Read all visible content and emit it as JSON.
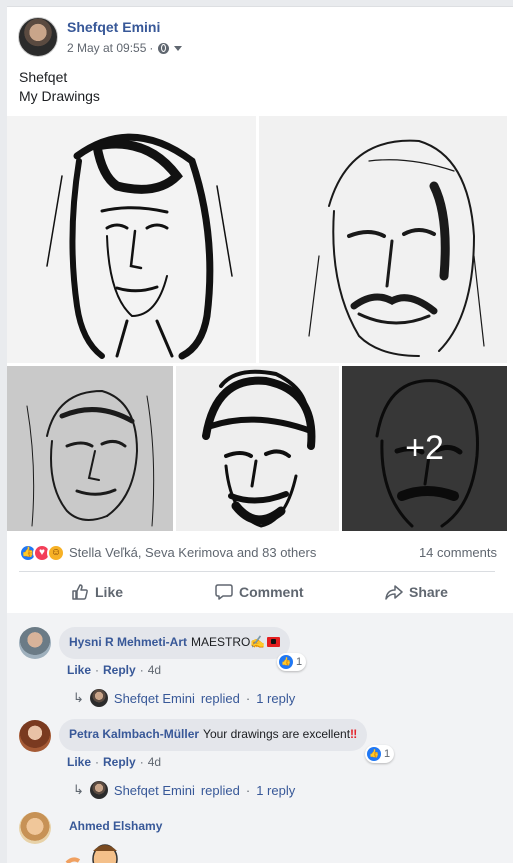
{
  "post": {
    "author": "Shefqet Emini",
    "timestamp": "2 May at 09:55",
    "meta_separator": "·",
    "text_lines": [
      "Shefqet",
      "My Drawings"
    ],
    "more_photos_label": "+2"
  },
  "reactions": {
    "names": "Stella Veľká, Seva Kerimova and 83 others",
    "comments_count": "14 comments",
    "icons": [
      "like-reaction-icon",
      "love-reaction-icon",
      "care-reaction-icon"
    ],
    "colors": {
      "like": "#2078f4",
      "love": "#f33e58",
      "care": "#f7b125"
    }
  },
  "actions": {
    "like": "Like",
    "comment": "Comment",
    "share": "Share"
  },
  "comments": [
    {
      "name": "Hysni R Mehmeti-Art",
      "text": "MAESTRO",
      "emoji": "✍",
      "like": "Like",
      "reply": "Reply",
      "time": "4d",
      "reaction_count": "1",
      "reply_preview": {
        "author": "Shefqet Emini",
        "verb": "replied",
        "sep": "·",
        "count": "1 reply"
      }
    },
    {
      "name": "Petra Kalmbach-Müller",
      "text": "Your drawings are excellent",
      "emoji": "‼",
      "like": "Like",
      "reply": "Reply",
      "time": "4d",
      "reaction_count": "1",
      "reply_preview": {
        "author": "Shefqet Emini",
        "verb": "replied",
        "sep": "·",
        "count": "1 reply"
      }
    },
    {
      "name": "Ahmed Elshamy"
    }
  ],
  "separators": {
    "dot": "·"
  },
  "theme": {
    "link": "#385898",
    "muted": "#606770",
    "bubble": "#e4e6eb",
    "background": "#e9ebee"
  }
}
